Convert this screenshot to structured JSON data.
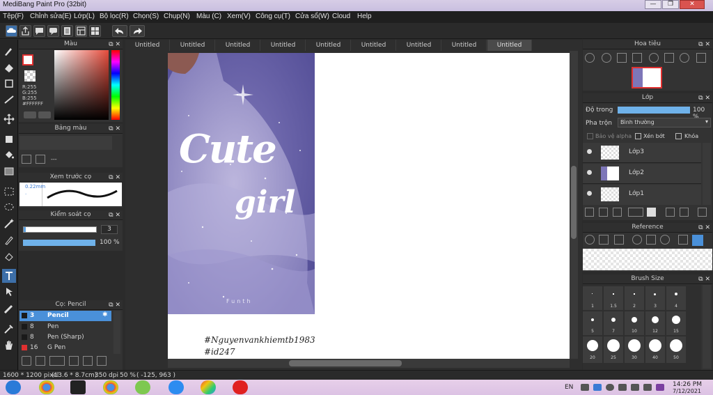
{
  "window": {
    "title": "MediBang Paint Pro (32bit)",
    "min": "—",
    "max": "❐",
    "close": "✕"
  },
  "menu": [
    "Tệp(F)",
    "Chỉnh sửa(E)",
    "Lớp(L)",
    "Bộ lọc(R)",
    "Chọn(S)",
    "Chụp(N)",
    "Màu (C)",
    "Xem(V)",
    "Công cụ(T)",
    "Cửa sổ(W)",
    "Cloud",
    "Help"
  ],
  "color_panel": {
    "title": "Màu",
    "r": "R:255",
    "g": "G:255",
    "b": "B:255",
    "hex": "#FFFFFF"
  },
  "palette_panel": {
    "title": "Bảng màu",
    "empty_label": "---"
  },
  "brush_preview": {
    "title": "Xem trước cọ",
    "size": "0.22mm",
    "dot": "."
  },
  "brush_control": {
    "title": "Kiểm soát cọ",
    "size_value": "3",
    "opacity_value": "100 %"
  },
  "brush_list": {
    "title": "Cọ: Pencil",
    "items": [
      {
        "size": "3",
        "name": "Pencil",
        "color": "#1a1a1a",
        "selected": true
      },
      {
        "size": "8",
        "name": "Pen",
        "color": "#1a1a1a",
        "selected": false
      },
      {
        "size": "8",
        "name": "Pen (Sharp)",
        "color": "#1a1a1a",
        "selected": false
      },
      {
        "size": "16",
        "name": "G Pen",
        "color": "#e03030",
        "selected": false
      }
    ]
  },
  "tabs": [
    "Untitled",
    "Untitled",
    "Untitled",
    "Untitled",
    "Untitled",
    "Untitled",
    "Untitled",
    "Untitled",
    "Untitled"
  ],
  "artwork": {
    "word1": "Cute",
    "word2": "girl",
    "signature": "Funth",
    "hashtag1": "#Nguyenvankhiemtb1983",
    "hashtag2": "#id247"
  },
  "navigator": {
    "title": "Hoa tiêu"
  },
  "layers": {
    "title": "Lớp",
    "opacity_label": "Độ trong",
    "opacity_value": "100 %",
    "blend_label": "Pha trộn",
    "blend_value": "Bình thường",
    "protect_alpha": "Bảo vệ alpha",
    "clip": "Xén bớt",
    "lock": "Khóa",
    "items": [
      "Lớp3",
      "Lớp2",
      "Lớp1"
    ]
  },
  "reference": {
    "title": "Reference"
  },
  "brush_size": {
    "title": "Brush Size",
    "rows": [
      [
        "1",
        "1.5",
        "2",
        "3",
        "4"
      ],
      [
        "5",
        "7",
        "10",
        "12",
        "15"
      ],
      [
        "20",
        "25",
        "30",
        "40",
        "50"
      ]
    ]
  },
  "status": {
    "size": "1600 * 1200 pixel",
    "cm": "(13.6 * 8.7cm)",
    "dpi": "350 dpi",
    "zoom": "50 %",
    "coords": "( -125, 963 )"
  },
  "taskbar": {
    "lang": "EN",
    "time": "14:26 PM",
    "date": "7/12/2021"
  }
}
